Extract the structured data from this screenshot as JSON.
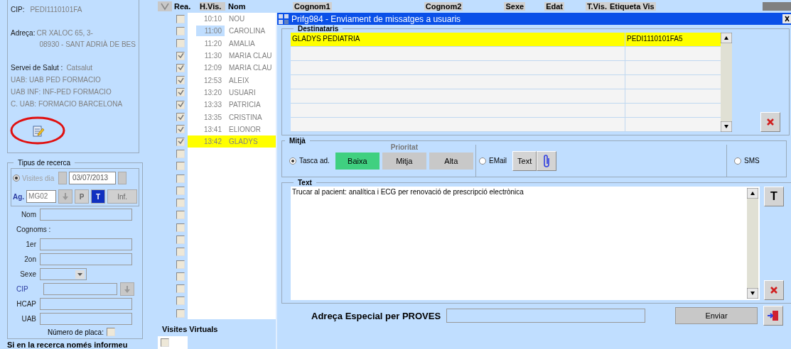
{
  "header": {
    "list_columns": [
      "Rea.",
      "H.Vis.",
      "Nom"
    ],
    "other_columns": [
      "Cognom1",
      "Cognom2",
      "Sexe",
      "Edat",
      "T.Vis.",
      "Etiqueta Vis"
    ]
  },
  "patient": {
    "cip_label": "CIP:",
    "cip": "PEDI1110101FA",
    "address_label": "Adreça:",
    "address_lines": [
      "CR XALOC  65, 3-",
      "08930 - SANT ADRIÀ DE BES"
    ],
    "service_label": "Servei de Salut :",
    "service": "Catsalut",
    "units": [
      "UAB: UAB PED FORMACIO",
      "UAB INF: INF-PED FORMACIO",
      "C. UAB: FORMACIO BARCELONA"
    ]
  },
  "search": {
    "title": "Tipus de recerca",
    "day_label": "Visites dia",
    "day_selected": true,
    "date": "03/07/2013",
    "agenda_label": "Ag.",
    "agenda": "MG02",
    "agenda_buttons": [
      {
        "label": "P",
        "selected": false,
        "disabled": true
      },
      {
        "label": "T",
        "selected": true,
        "disabled": false
      },
      {
        "label": "Inf.",
        "selected": false,
        "disabled": true
      }
    ],
    "fields": [
      {
        "kind": "text",
        "label": "Nom"
      },
      {
        "kind": "heading",
        "label": "Cognoms :"
      },
      {
        "kind": "text",
        "label": "1er"
      },
      {
        "kind": "text",
        "label": "2on"
      },
      {
        "kind": "select",
        "label": "Sexe"
      },
      {
        "kind": "lookup",
        "label": "CIP"
      },
      {
        "kind": "text",
        "label": "HCAP"
      },
      {
        "kind": "text",
        "label": "UAB"
      }
    ],
    "plate_label": "Número de placa:",
    "plate_checked": false,
    "note": "Si en la recerca només informeu"
  },
  "visits": [
    {
      "checked": false,
      "time": "10:10",
      "name": "NOU",
      "selected": false,
      "focused": false
    },
    {
      "checked": false,
      "time": "11:00",
      "name": "CAROLINA",
      "selected": false,
      "focused": true
    },
    {
      "checked": false,
      "time": "11:20",
      "name": "AMALIA",
      "selected": false,
      "focused": false
    },
    {
      "checked": true,
      "time": "11:30",
      "name": "MARIA CLAU",
      "selected": false,
      "focused": false
    },
    {
      "checked": true,
      "time": "12:09",
      "name": "MARIA CLAU",
      "selected": false,
      "focused": false
    },
    {
      "checked": true,
      "time": "12:53",
      "name": "ALEIX",
      "selected": false,
      "focused": false
    },
    {
      "checked": true,
      "time": "13:20",
      "name": "USUARI",
      "selected": false,
      "focused": false
    },
    {
      "checked": true,
      "time": "13:33",
      "name": "PATRICIA",
      "selected": false,
      "focused": false
    },
    {
      "checked": true,
      "time": "13:35",
      "name": "CRISTINA",
      "selected": false,
      "focused": false
    },
    {
      "checked": true,
      "time": "13:41",
      "name": "ELIONOR",
      "selected": false,
      "focused": false
    },
    {
      "checked": true,
      "time": "13:42",
      "name": "GLADYS",
      "selected": true,
      "focused": false
    },
    {
      "checked": false
    },
    {
      "checked": false
    },
    {
      "checked": false
    },
    {
      "checked": false
    },
    {
      "checked": false
    },
    {
      "checked": false
    },
    {
      "checked": false
    },
    {
      "checked": false
    },
    {
      "checked": false
    },
    {
      "checked": false
    },
    {
      "checked": false
    },
    {
      "checked": false
    },
    {
      "checked": false
    },
    {
      "checked": false
    }
  ],
  "virtual_visits": {
    "title": "Visites Virtuals",
    "rows": [
      {
        "checked": false
      }
    ]
  },
  "dialog": {
    "title": "Prifg984 - Enviament de missatges a usuaris",
    "recipients": {
      "title": "Destinataris",
      "rows": [
        {
          "name": "GLADYS PEDIATRIA",
          "cip": "PEDI1110101FA5",
          "selected": true
        },
        {
          "selected": false
        },
        {
          "selected": false
        },
        {
          "selected": false
        },
        {
          "selected": false
        },
        {
          "selected": false
        },
        {
          "selected": false
        }
      ]
    },
    "channel": {
      "title": "Mitjà",
      "task_label": "Tasca ad.",
      "task_selected": true,
      "priority_label": "Prioritat",
      "priorities": [
        {
          "label": "Baixa",
          "selected": true
        },
        {
          "label": "Mitja",
          "selected": false
        },
        {
          "label": "Alta",
          "selected": false
        }
      ],
      "email_label": "EMail",
      "email_selected": false,
      "text_button": "Text",
      "sms_label": "SMS",
      "sms_selected": false
    },
    "message": {
      "title": "Text",
      "value": "Trucar al pacient: analítica i ECG per renovació de prescripció electrònica",
      "format_button": "T"
    },
    "special_address": {
      "label": "Adreça Especial per PROVES"
    },
    "send_button": "Enviar"
  }
}
